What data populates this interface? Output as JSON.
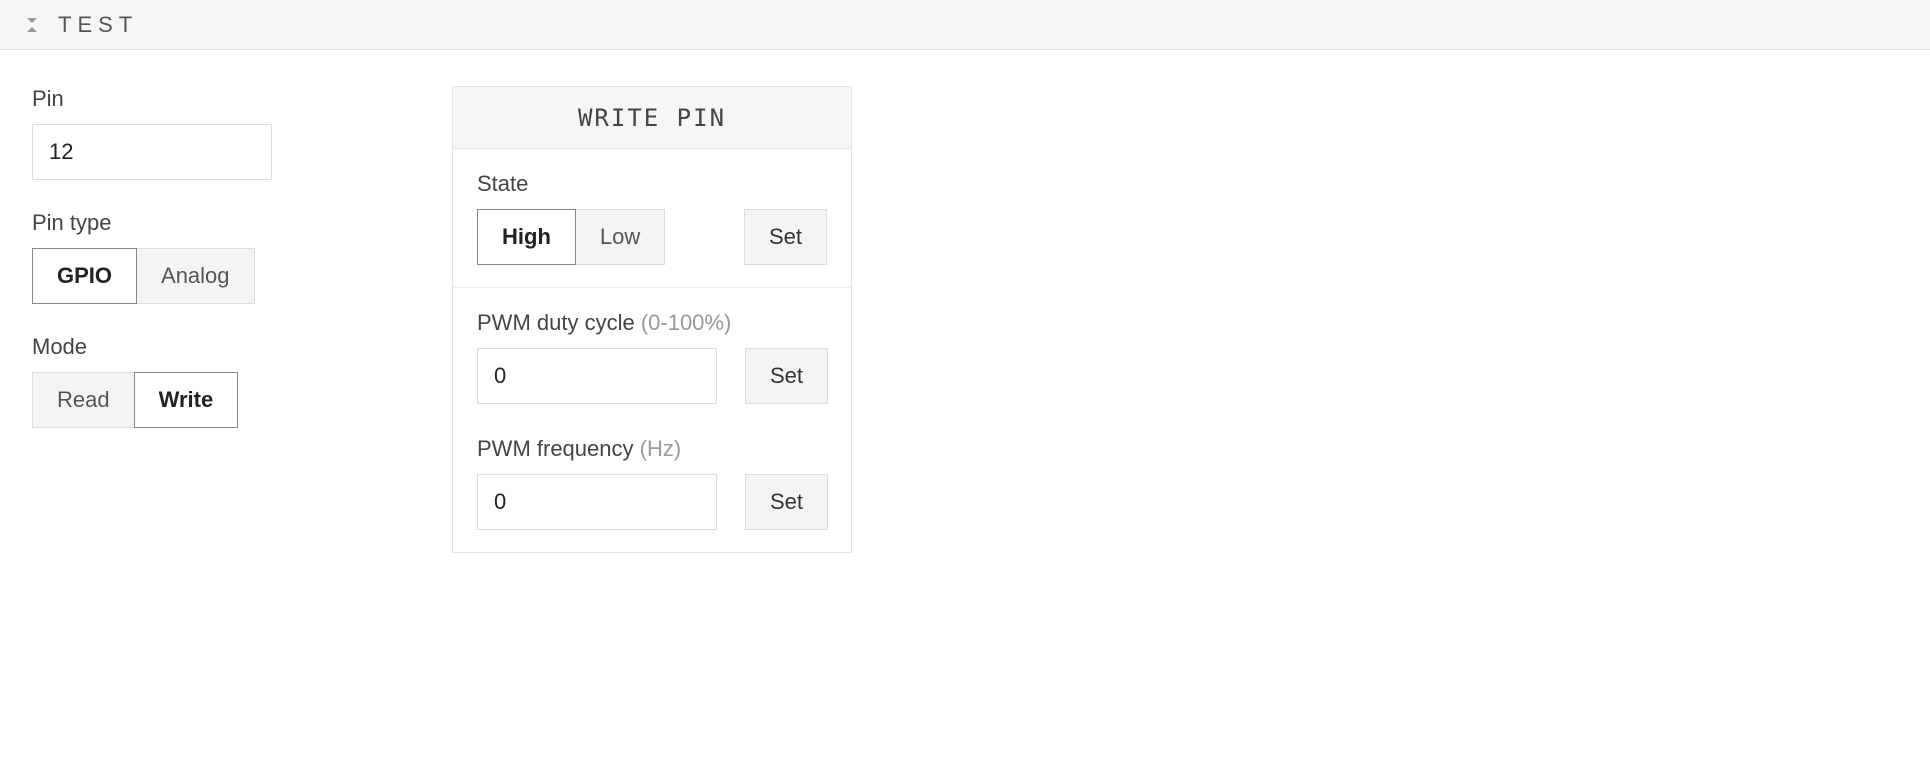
{
  "topbar": {
    "title": "TEST"
  },
  "pin": {
    "label": "Pin",
    "value": "12"
  },
  "pin_type": {
    "label": "Pin type",
    "options": {
      "gpio": "GPIO",
      "analog": "Analog"
    },
    "selected": "gpio"
  },
  "mode": {
    "label": "Mode",
    "options": {
      "read": "Read",
      "write": "Write"
    },
    "selected": "write"
  },
  "write_panel": {
    "title": "WRITE PIN",
    "state": {
      "label": "State",
      "options": {
        "high": "High",
        "low": "Low"
      },
      "selected": "high",
      "set_label": "Set"
    },
    "pwm_duty": {
      "label": "PWM duty cycle",
      "hint": "(0-100%)",
      "value": "0",
      "set_label": "Set"
    },
    "pwm_freq": {
      "label": "PWM frequency",
      "hint": "(Hz)",
      "value": "0",
      "set_label": "Set"
    }
  }
}
